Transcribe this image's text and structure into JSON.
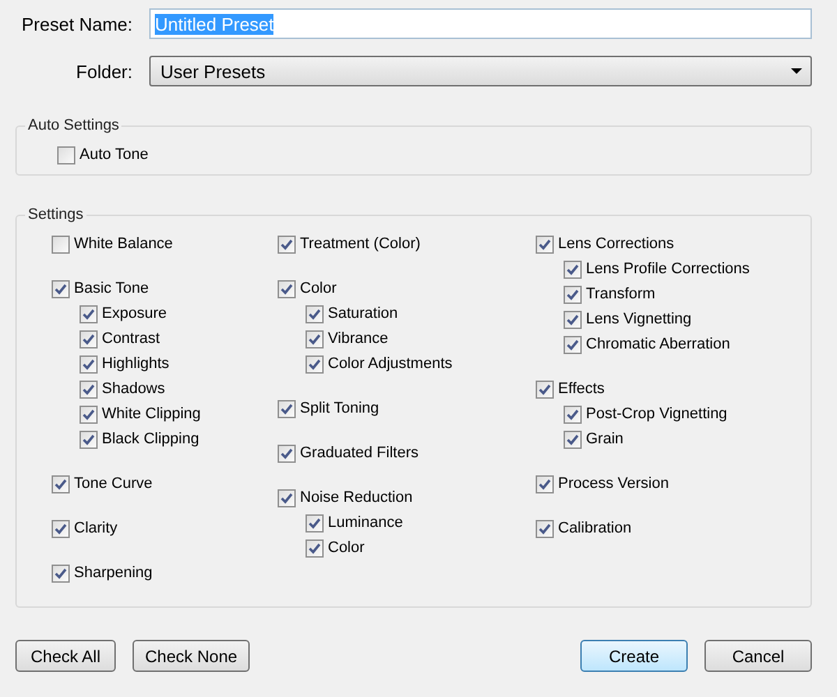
{
  "preset_name": {
    "label": "Preset Name:",
    "value": "Untitled Preset"
  },
  "folder": {
    "label": "Folder:",
    "value": "User Presets"
  },
  "auto_settings": {
    "title": "Auto Settings",
    "items": [
      {
        "label": "Auto Tone",
        "checked": false
      }
    ]
  },
  "settings": {
    "title": "Settings",
    "columns": [
      [
        {
          "label": "White Balance",
          "checked": false
        },
        {
          "label": "Basic Tone",
          "checked": true,
          "children": [
            {
              "label": "Exposure",
              "checked": true
            },
            {
              "label": "Contrast",
              "checked": true
            },
            {
              "label": "Highlights",
              "checked": true
            },
            {
              "label": "Shadows",
              "checked": true
            },
            {
              "label": "White Clipping",
              "checked": true
            },
            {
              "label": "Black Clipping",
              "checked": true
            }
          ]
        },
        {
          "label": "Tone Curve",
          "checked": true
        },
        {
          "label": "Clarity",
          "checked": true
        },
        {
          "label": "Sharpening",
          "checked": true
        }
      ],
      [
        {
          "label": "Treatment (Color)",
          "checked": true
        },
        {
          "label": "Color",
          "checked": true,
          "children": [
            {
              "label": "Saturation",
              "checked": true
            },
            {
              "label": "Vibrance",
              "checked": true
            },
            {
              "label": "Color Adjustments",
              "checked": true
            }
          ]
        },
        {
          "label": "Split Toning",
          "checked": true
        },
        {
          "label": "Graduated Filters",
          "checked": true
        },
        {
          "label": "Noise Reduction",
          "checked": true,
          "children": [
            {
              "label": "Luminance",
              "checked": true
            },
            {
              "label": "Color",
              "checked": true
            }
          ]
        }
      ],
      [
        {
          "label": "Lens Corrections",
          "checked": true,
          "children": [
            {
              "label": "Lens Profile Corrections",
              "checked": true
            },
            {
              "label": "Transform",
              "checked": true
            },
            {
              "label": "Lens Vignetting",
              "checked": true
            },
            {
              "label": "Chromatic Aberration",
              "checked": true
            }
          ]
        },
        {
          "label": "Effects",
          "checked": true,
          "children": [
            {
              "label": "Post-Crop Vignetting",
              "checked": true
            },
            {
              "label": "Grain",
              "checked": true
            }
          ]
        },
        {
          "label": "Process Version",
          "checked": true
        },
        {
          "label": "Calibration",
          "checked": true
        }
      ]
    ]
  },
  "buttons_left": [
    {
      "label": "Check All",
      "default": false
    },
    {
      "label": "Check None",
      "default": false
    }
  ],
  "buttons_right": [
    {
      "label": "Create",
      "default": true
    },
    {
      "label": "Cancel",
      "default": false
    }
  ]
}
